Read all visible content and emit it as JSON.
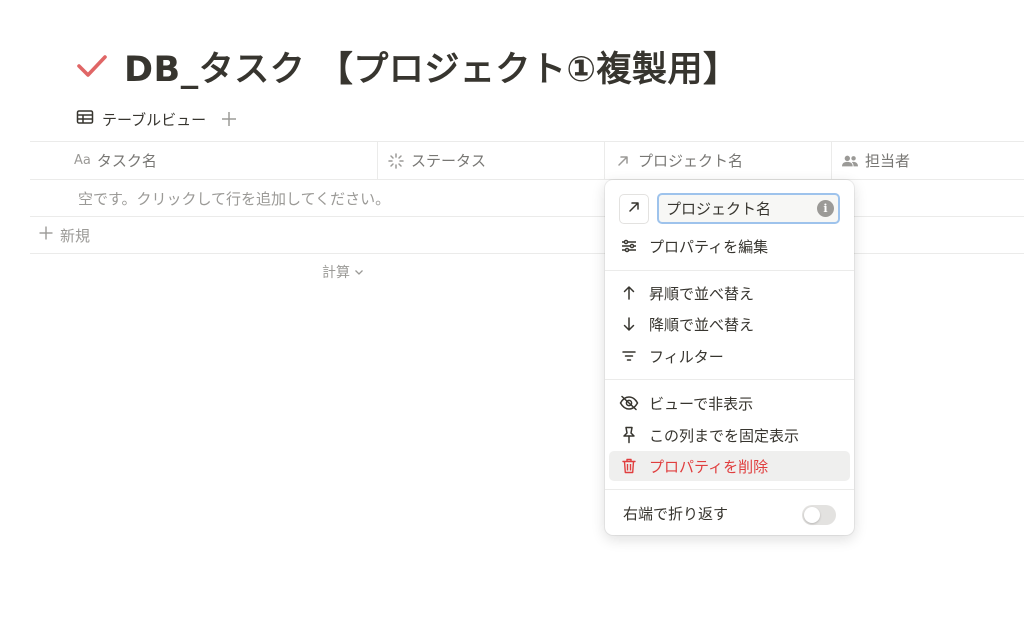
{
  "page": {
    "title": "DB_タスク 【プロジェクト①複製用】",
    "icon": "checkmark-icon",
    "icon_color": "#e03e3e"
  },
  "views": {
    "tabs": [
      {
        "label": "テーブルビュー",
        "icon": "table-icon"
      }
    ],
    "add_icon": "plus-icon"
  },
  "table": {
    "columns": [
      {
        "label": "タスク名",
        "prefix": "Aa",
        "icon": "title-aa-icon"
      },
      {
        "label": "ステータス",
        "icon": "status-spinner-icon"
      },
      {
        "label": "プロジェクト名",
        "icon": "relation-arrow-icon"
      },
      {
        "label": "担当者",
        "icon": "people-icon"
      }
    ],
    "empty_message": "空です。クリックして行を追加してください。",
    "new_label": "新規",
    "calc_label": "計算"
  },
  "menu": {
    "name_value": "プロジェクト名",
    "edit_property": "プロパティを編集",
    "sort_asc": "昇順で並べ替え",
    "sort_desc": "降順で並べ替え",
    "filter": "フィルター",
    "hide_in_view": "ビューで非表示",
    "freeze": "この列までを固定表示",
    "delete_property": "プロパティを削除",
    "wrap_column": "右端で折り返す",
    "wrap_enabled": false,
    "danger_color": "#e03e3e"
  }
}
